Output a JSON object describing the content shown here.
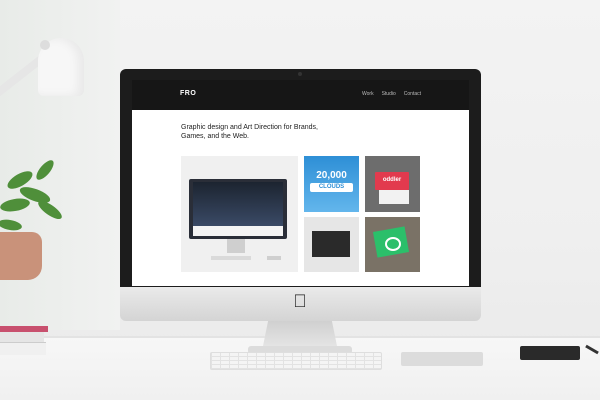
{
  "scene": {
    "background": "#f0f0f0",
    "desk_color": "#f4f4f4",
    "device": "imac",
    "icons": [
      "apple-logo-icon",
      "desk-lamp",
      "plant",
      "keyboard",
      "trackpad",
      "notebook"
    ]
  },
  "website": {
    "logo": "FRO",
    "nav": [
      "Work",
      "Studio",
      "Contact"
    ],
    "tagline": "Graphic design and Art Direction for Brands, Games, and the Web.",
    "colors": {
      "nav_bg": "#161616",
      "accent_red": "#e23a4e",
      "accent_green": "#2bbf6a",
      "accent_blue": "#2e8fd6"
    },
    "tiles": {
      "clouds_number": "20,000",
      "clouds_word": "CLOUDS",
      "oddler_brand": "oddler"
    }
  }
}
